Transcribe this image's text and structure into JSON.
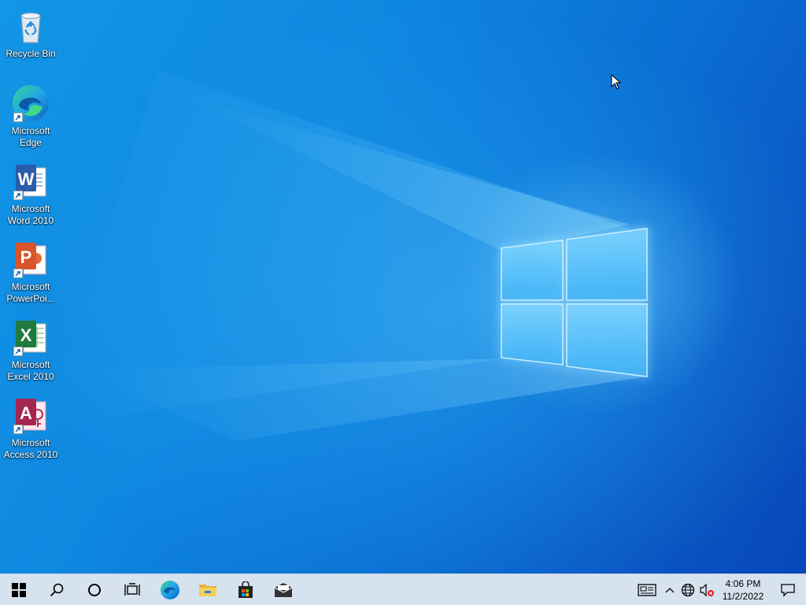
{
  "desktop": {
    "icons": [
      {
        "label": "Recycle Bin"
      },
      {
        "label": "Microsoft Edge"
      },
      {
        "label": "Microsoft Word 2010"
      },
      {
        "label": "Microsoft PowerPoi..."
      },
      {
        "label": "Microsoft Excel 2010"
      },
      {
        "label": "Microsoft Access 2010"
      }
    ]
  },
  "taskbar": {
    "buttons": [
      {
        "name": "start",
        "icon": "windows-logo-icon"
      },
      {
        "name": "search",
        "icon": "search-icon"
      },
      {
        "name": "cortana",
        "icon": "cortana-circle-icon"
      },
      {
        "name": "task-view",
        "icon": "task-view-icon"
      },
      {
        "name": "edge",
        "icon": "edge-icon"
      },
      {
        "name": "file-explorer",
        "icon": "folder-icon"
      },
      {
        "name": "store",
        "icon": "store-bag-icon"
      },
      {
        "name": "mail",
        "icon": "mail-icon"
      }
    ],
    "tray": {
      "time": "4:06 PM",
      "date": "11/2/2022"
    }
  },
  "colors": {
    "taskbar": "#d7e2ef",
    "wallpaper_light": "#1296e6",
    "wallpaper_dark": "#0847b8"
  }
}
